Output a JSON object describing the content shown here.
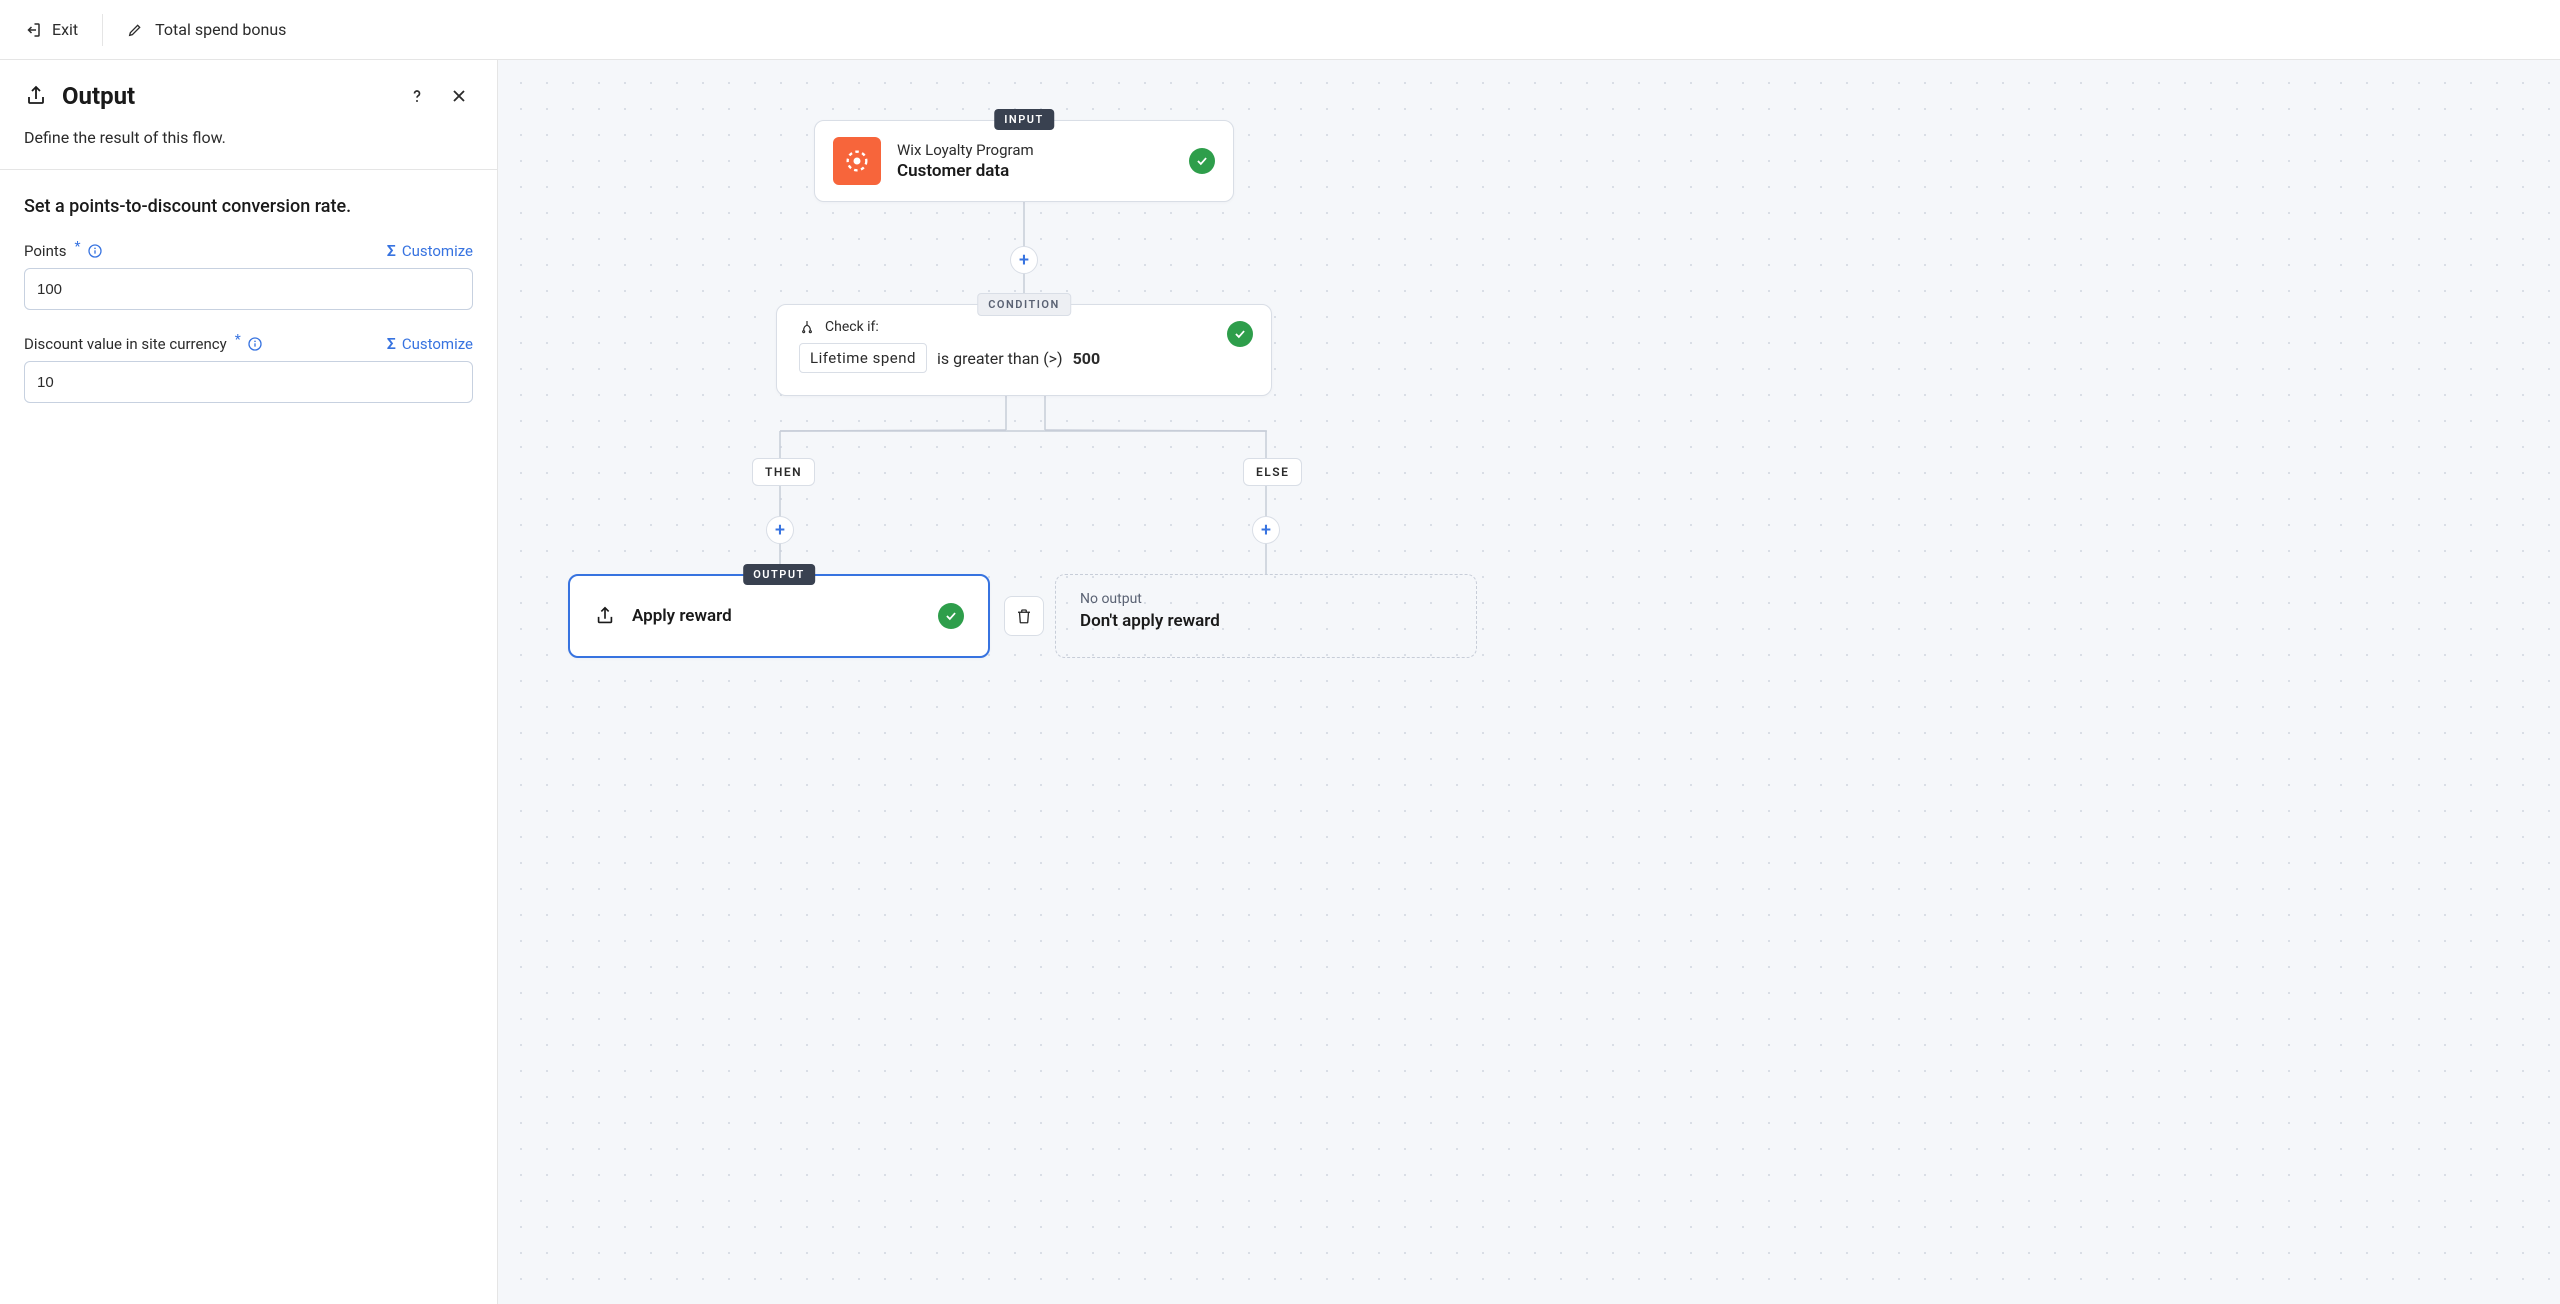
{
  "topbar": {
    "exit_label": "Exit",
    "title": "Total spend bonus"
  },
  "sidebar": {
    "title": "Output",
    "subtitle": "Define the result of this flow.",
    "section_heading": "Set a points-to-discount conversion rate.",
    "fields": {
      "points": {
        "label": "Points",
        "customize": "Customize",
        "value": "100"
      },
      "discount": {
        "label": "Discount value in site currency",
        "customize": "Customize",
        "value": "10"
      }
    }
  },
  "canvas": {
    "badges": {
      "input": "INPUT",
      "condition": "CONDITION",
      "output": "OUTPUT",
      "then": "THEN",
      "else": "ELSE"
    },
    "input_node": {
      "app_name": "Wix Loyalty Program",
      "data_name": "Customer data"
    },
    "condition_node": {
      "check_if": "Check if:",
      "field": "Lifetime spend",
      "operator": "is greater than (>)",
      "value": "500"
    },
    "output_node": {
      "label": "Apply reward"
    },
    "else_node": {
      "no_output": "No output",
      "label": "Don't apply reward"
    }
  }
}
